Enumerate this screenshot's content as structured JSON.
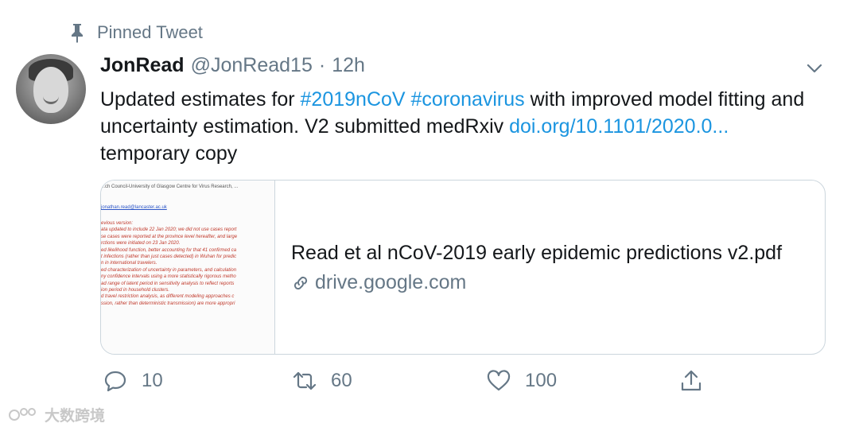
{
  "pinned": {
    "label": "Pinned Tweet",
    "icon": "pin-icon"
  },
  "author": {
    "name": "JonRead",
    "handle": "@JonRead15",
    "separator": "·",
    "time": "12h"
  },
  "tweet": {
    "text_1": "Updated estimates for ",
    "hashtag_1": "#2019nCoV",
    "space_1": " ",
    "hashtag_2": "#coronavirus",
    "text_2": " with improved model fitting and uncertainty estimation. V2 submitted medRxiv ",
    "link": "doi.org/10.1101/2020.0...",
    "text_3": " temporary copy"
  },
  "card": {
    "title": "Read et al nCoV-2019 early epidemic predictions v2.pdf",
    "domain": "drive.google.com",
    "thumbnail": {
      "header": "...ch Council-University of Glasgow Centre for Virus Research, ...",
      "email": "jonathan.read@lancaster.ac.uk",
      "lines": [
        "evious version:",
        "ata updated to include 22 Jan 2020; we did not use cases report",
        "se cases were reported at the province level hereafter, and large",
        "rctions were initiated on 23 Jan 2020.",
        "ed likelihood function, better accounting for that 41 confirmed ca",
        "t infections (rather than just cases detected) in Wuhan for predic",
        "n in international travelers.",
        "ed characterization of uncertainty in parameters, and calculation",
        "ny confidence intervals using a more statistically rigorous metho",
        "ad range of latent period in sensitivity analysis to reflect reports",
        "ion period in household clusters.",
        "d travel restriction analysis, as different modeling approaches c",
        "ssion, rather than deterministic transmission) are more appropri"
      ]
    }
  },
  "actions": {
    "reply_count": "10",
    "retweet_count": "60",
    "like_count": "100"
  },
  "watermark": {
    "text": "大数跨境"
  },
  "colors": {
    "link": "#1b95e0",
    "secondary": "#657786",
    "border": "#ccd6dd",
    "thumb_text": "#c0392b"
  }
}
